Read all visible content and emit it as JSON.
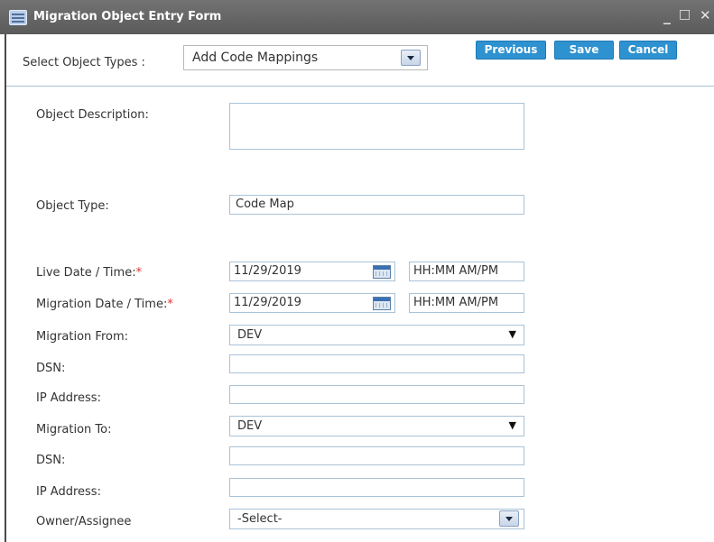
{
  "window": {
    "title": "Migration Object Entry Form",
    "minimize_glyph": "_",
    "maximize_glyph": "□",
    "close_glyph": "✕"
  },
  "header": {
    "select_label": "Select Object Types :",
    "select_value": "Add Code Mappings",
    "previous_label": "Previous",
    "save_label": "Save",
    "cancel_label": "Cancel"
  },
  "form": {
    "object_description_label": "Object Description:",
    "object_description_value": "",
    "object_type_label": "Object Type:",
    "object_type_value": "Code Map",
    "live_label": "Live Date / Time:",
    "live_date": "11/29/2019",
    "live_time": "HH:MM AM/PM",
    "migration_label": "Migration Date / Time:",
    "migration_date": "11/29/2019",
    "migration_time": "HH:MM AM/PM",
    "required_marker": "*",
    "migration_from_label": "Migration From:",
    "migration_from_value": "DEV",
    "dsn_from_label": "DSN:",
    "dsn_from_value": "",
    "ip_from_label": "IP Address:",
    "ip_from_value": "",
    "migration_to_label": "Migration To:",
    "migration_to_value": "DEV",
    "dsn_to_label": "DSN:",
    "dsn_to_value": "",
    "ip_to_label": "IP Address:",
    "ip_to_value": "",
    "owner_label": "Owner/Assignee",
    "owner_value": "-Select-",
    "caret_glyph": "▼"
  },
  "colors": {
    "titlebar": "#666666",
    "button": "#2e92d1",
    "field_border": "#a9c3d9",
    "required": "#dd3333"
  }
}
